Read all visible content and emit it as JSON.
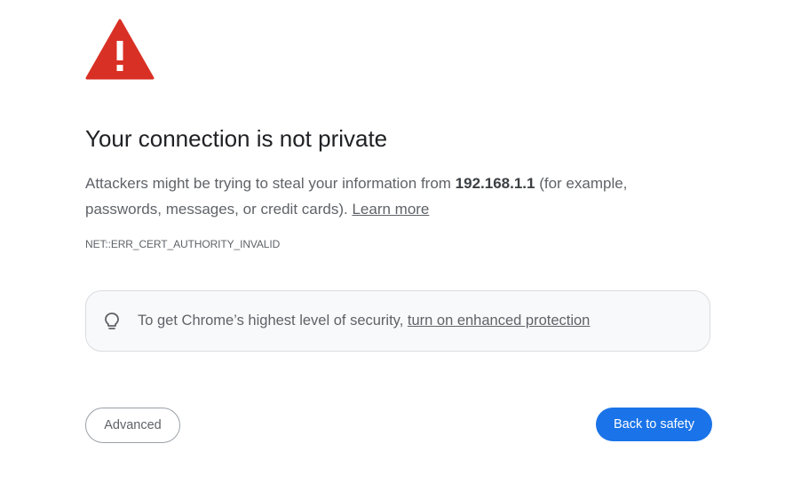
{
  "icons": {
    "warning": "warning-triangle-icon",
    "tip": "lightbulb-icon"
  },
  "colors": {
    "warning_red": "#d93025",
    "primary_blue": "#1a73e8",
    "text_secondary": "#5f6368"
  },
  "title": "Your connection is not private",
  "description": {
    "before_host": "Attackers might be trying to steal your information from ",
    "host": "192.168.1.1",
    "after_host": " (for example, passwords, messages, or credit cards). ",
    "learn_more": "Learn more"
  },
  "error_code": "NET::ERR_CERT_AUTHORITY_INVALID",
  "tip": {
    "text": "To get Chrome’s highest level of security, ",
    "link": "turn on enhanced protection"
  },
  "buttons": {
    "advanced": "Advanced",
    "back_to_safety": "Back to safety"
  }
}
